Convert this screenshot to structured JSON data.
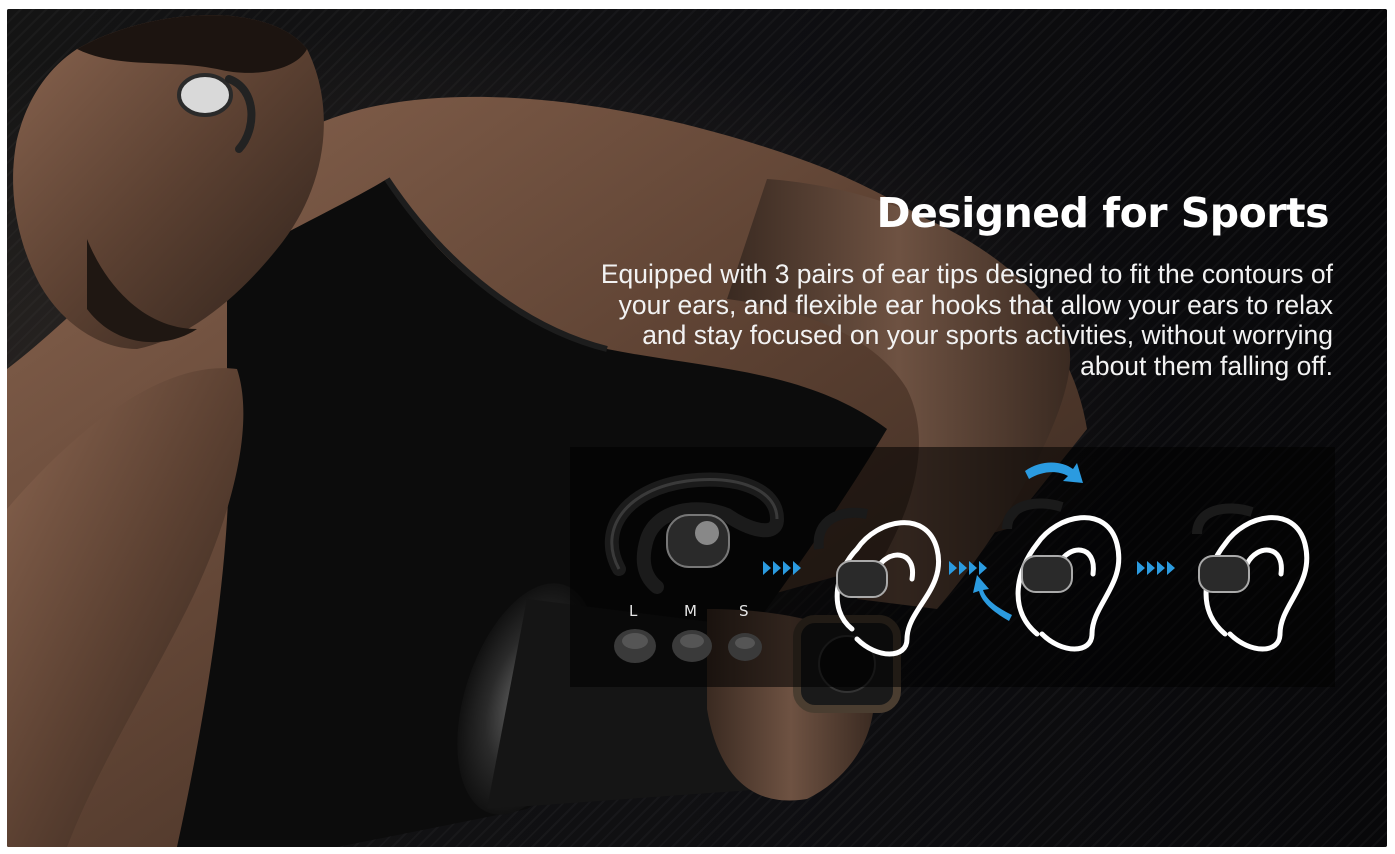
{
  "headline": "Designed for Sports",
  "description": "Equipped with 3 pairs of ear tips designed to fit the contours of your ears, and flexible ear hooks that allow your ears to relax and stay focused on your sports activities, without worrying about them falling off.",
  "ear_tip_sizes": [
    "L",
    "M",
    "S"
  ],
  "icons": [
    "earbud-with-hook-icon",
    "ear-tip-icon",
    "ear-outline-icon",
    "chevrons-right-icon",
    "rotate-arrow-icon"
  ],
  "colors": {
    "accent_blue": "#2b9be0",
    "text": "#ffffff",
    "background": "#0b0b0b"
  }
}
